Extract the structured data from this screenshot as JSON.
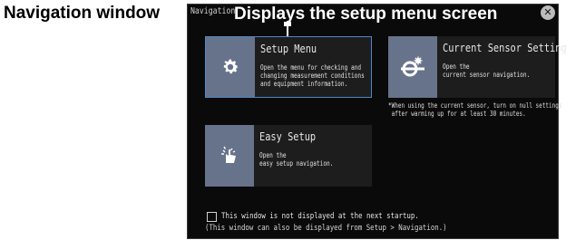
{
  "outer_label": "Navigation window",
  "window": {
    "title": "Navigation",
    "callout": "Displays the setup menu screen",
    "close_icon": "close-circle-icon"
  },
  "cards": [
    {
      "id": "setup-menu",
      "title": "Setup Menu",
      "description": "Open the menu for checking and\nchanging measurement conditions\nand equipment information.",
      "icon": "gear-icon",
      "selected": true
    },
    {
      "id": "current-sensor",
      "title": "Current Sensor Settings",
      "description": "Open the\ncurrent sensor navigation.",
      "icon": "current-sensor-icon",
      "selected": false
    },
    {
      "id": "easy-setup",
      "title": "Easy Setup",
      "description": "Open the\neasy setup navigation.",
      "icon": "easy-setup-icon",
      "selected": false
    }
  ],
  "sensor_note": "*When using the current sensor, turn on null settings\n after warming up for at least 30 minutes.",
  "startup": {
    "checkbox_label": "This window is not displayed at the next startup.",
    "checked": false,
    "hint": "(This window can also be displayed from Setup > Navigation.)"
  },
  "colors": {
    "window_bg": "#0a0a0a",
    "card_bg": "#1d1d1d",
    "icon_bg": "#67738a",
    "selected_border": "#4f86c9"
  }
}
